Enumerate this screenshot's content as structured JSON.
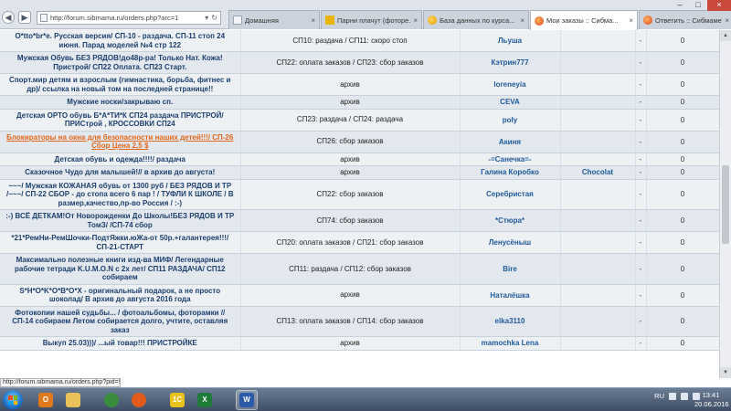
{
  "browser": {
    "url": "http://forum.sibmama.ru/orders.php?arc=1",
    "tabs": [
      {
        "label": "Домашняя",
        "icon": "blank-page-icon",
        "active": false
      },
      {
        "label": "Парни плачут (фоторе...",
        "icon": "bolt-icon",
        "active": false
      },
      {
        "label": "База данных по курса...",
        "icon": "search-icon",
        "active": false
      },
      {
        "label": "Мои заказы :: Сибма...",
        "icon": "sibmama-icon",
        "active": true
      },
      {
        "label": "Ответить :: Сибмаме -...",
        "icon": "sibmama-icon",
        "active": false
      }
    ]
  },
  "rows": [
    {
      "title": "O*tto*br*e. Русская версия/ СП-10 - раздача. СП-11 стоп 24 июня. Парад моделей №4 стр 122",
      "status": "СП10: раздача / СП11: скоро стоп",
      "author": "Льуша",
      "last": "",
      "dash": "-",
      "count": "0",
      "highlight": false
    },
    {
      "title": "Мужская Обувь БЕЗ РЯДОВ!до48р-ра! Только Нат. Кожа! Пристрой/ СП22 Оплата. СП23 Старт.",
      "status": "СП22: оплата заказов / СП23: сбор заказов",
      "author": "Кэтрин777",
      "last": "",
      "dash": "-",
      "count": "0",
      "highlight": false
    },
    {
      "title": "Спорт.мир детям и взрослым (гимнастика, борьба, фитнес и др)/ ссылка на новый том на последней странице!!",
      "status": "архив",
      "author": "lorenеyia",
      "last": "",
      "dash": "-",
      "count": "0",
      "highlight": false
    },
    {
      "title": "Мужские носки/закрываю сп.",
      "status": "архив",
      "author": "CEVA",
      "last": "",
      "dash": "-",
      "count": "0",
      "highlight": false
    },
    {
      "title": "Детская ОРТО обувь Б*А*ТИ*К СП24 раздача ПРИСТРОЙ/ ПРИСтрой , КРОССОВКИ СП24",
      "status": "СП23: раздача / СП24: раздача",
      "author": "poly",
      "last": "",
      "dash": "-",
      "count": "0",
      "highlight": false
    },
    {
      "title": "Блокираторы на окна для безопасности наших детей!!!/ СП-26 Сбор Цена 2,5 $",
      "status": "СП26: сбор заказов",
      "author": "Акиня",
      "last": "",
      "dash": "-",
      "count": "0",
      "highlight": true
    },
    {
      "title": "Детская обувь и одежда!!!!/ раздача",
      "status": "архив",
      "author": "-=Санечка=-",
      "last": "",
      "dash": "-",
      "count": "0",
      "highlight": false
    },
    {
      "title": "Сказочное Чудо для малышей!// в архив до августа!",
      "status": "архив",
      "author": "Галина Коробко",
      "last": "Chocolat",
      "dash": "-",
      "count": "0",
      "highlight": false
    },
    {
      "title": "~~~/ Мужская КОЖАНАЯ обувь от 1300 руб / БЕЗ РЯДОВ И ТР /~~~/ СП-22 СБОР - до стопа всего 6 пар ! / ТУФЛИ К ШКОЛЕ / В размер,качество,пр-во Россия / :-)",
      "status": "СП22: сбор заказов",
      "author": "Серебристая",
      "last": "",
      "dash": "-",
      "count": "0",
      "highlight": false
    },
    {
      "title": ":-) ВСЁ ДЕТКАМ!От Новорожденки До Школы!БЕЗ РЯДОВ И ТР ТомЗ/ /СП-74 сбор",
      "status": "СП74: сбор заказов",
      "author": "*Стюра*",
      "last": "",
      "dash": "-",
      "count": "0",
      "highlight": false
    },
    {
      "title": "*21*РемНи-РемШочки-ПодтЯжки.юЖа-от 50р.+галантерея!!!/ СП-21-СТАРТ",
      "status": "СП20: оплата заказов / СП21: сбор заказов",
      "author": "Ленусёныш",
      "last": "",
      "dash": "-",
      "count": "0",
      "highlight": false
    },
    {
      "title": "Максимально полезные книги изд-ва МИФ/ Легендарные рабочие тетради K.U.M.O.N с 2х лет/ СП11 РАЗДАЧА/ СП12 собираем",
      "status": "СП11: раздача / СП12: сбор заказов",
      "author": "Bire",
      "last": "",
      "dash": "-",
      "count": "0",
      "highlight": false
    },
    {
      "title": "S*H*O*K*O*B*O*X - оригинальный подарок, а не просто шоколад/ В архив до августа 2016 года",
      "status": "архив",
      "author": "Наталёшка",
      "last": "",
      "dash": "-",
      "count": "0",
      "highlight": false
    },
    {
      "title": "Фотокопии нашей судьбы... / фотоальбомы, фоторамки // СП-14 собираем Летом собирается долго, учтите, оставляя заказ",
      "status": "СП13: оплата заказов / СП14: сбор заказов",
      "author": "elka3110",
      "last": "",
      "dash": "-",
      "count": "0",
      "highlight": false
    },
    {
      "title": "Выкуп 25.03)))/ ...ый товар!!! ПРИСТРОЙКЕ",
      "status": "архив",
      "author": "mamochka Lena",
      "last": "",
      "dash": "-",
      "count": "0",
      "highlight": false
    }
  ],
  "status_url": "http://forum.sibmama.ru/orders.php?pid=990892",
  "taskbar": {
    "apps": [
      {
        "name": "outlook-icon",
        "label": "O",
        "color": "#e07a1c"
      },
      {
        "name": "explorer-icon",
        "label": "",
        "color": "#e8c35a"
      },
      {
        "name": "chrome-icon",
        "label": "",
        "color": "#3a8d3d"
      },
      {
        "name": "firefox-icon",
        "label": "",
        "color": "#e25a1c"
      },
      {
        "name": "1c-icon",
        "label": "1С",
        "color": "#e9c21b"
      },
      {
        "name": "excel-icon",
        "label": "X",
        "color": "#1f7a3c"
      },
      {
        "name": "word-icon",
        "label": "W",
        "color": "#2a5aa8"
      }
    ],
    "lang": "RU",
    "time": "13:41",
    "date": "20.06.2016"
  }
}
